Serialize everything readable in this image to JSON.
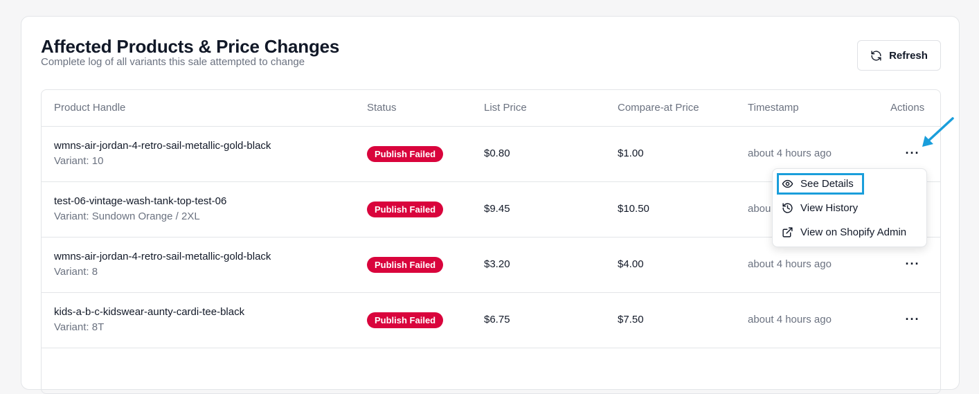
{
  "header": {
    "title": "Affected Products & Price Changes",
    "subtitle": "Complete log of all variants this sale attempted to change",
    "refresh_label": "Refresh"
  },
  "table": {
    "columns": [
      "Product Handle",
      "Status",
      "List Price",
      "Compare-at Price",
      "Timestamp",
      "Actions"
    ],
    "rows": [
      {
        "handle": "wmns-air-jordan-4-retro-sail-metallic-gold-black",
        "variant": "Variant: 10",
        "status": "Publish Failed",
        "list_price": "$0.80",
        "compare_price": "$1.00",
        "timestamp": "about 4 hours ago"
      },
      {
        "handle": "test-06-vintage-wash-tank-top-test-06",
        "variant": "Variant: Sundown Orange / 2XL",
        "status": "Publish Failed",
        "list_price": "$9.45",
        "compare_price": "$10.50",
        "timestamp": "abou"
      },
      {
        "handle": "wmns-air-jordan-4-retro-sail-metallic-gold-black",
        "variant": "Variant: 8",
        "status": "Publish Failed",
        "list_price": "$3.20",
        "compare_price": "$4.00",
        "timestamp": "about 4 hours ago"
      },
      {
        "handle": "kids-a-b-c-kidswear-aunty-cardi-tee-black",
        "variant": "Variant: 8T",
        "status": "Publish Failed",
        "list_price": "$6.75",
        "compare_price": "$7.50",
        "timestamp": "about 4 hours ago"
      }
    ],
    "more_glyph": "···"
  },
  "menu": {
    "items": [
      {
        "label": "See Details",
        "icon": "eye-icon"
      },
      {
        "label": "View History",
        "icon": "history-icon"
      },
      {
        "label": "View on Shopify Admin",
        "icon": "external-link-icon"
      }
    ]
  },
  "colors": {
    "badge_bg": "#d9043c",
    "highlight": "#1a9edb",
    "arrow": "#1a9edb"
  }
}
